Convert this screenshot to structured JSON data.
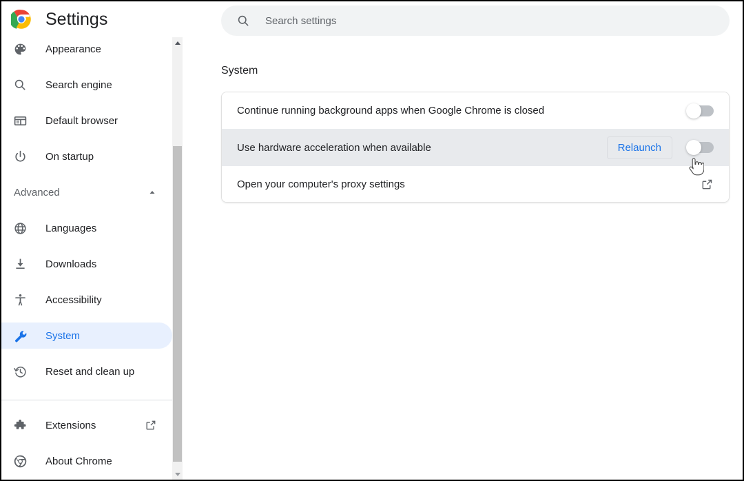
{
  "app": {
    "title": "Settings",
    "logo_icon": "chrome-logo"
  },
  "search": {
    "placeholder": "Search settings",
    "value": "",
    "icon": "search-icon"
  },
  "sidebar": {
    "items_top": [
      {
        "label": "Appearance",
        "icon": "palette-icon",
        "selected": false
      },
      {
        "label": "Search engine",
        "icon": "search-icon",
        "selected": false
      },
      {
        "label": "Default browser",
        "icon": "browser-window-icon",
        "selected": false
      },
      {
        "label": "On startup",
        "icon": "power-icon",
        "selected": false
      }
    ],
    "section": {
      "label": "Advanced",
      "chevron_icon": "chevron-up-icon",
      "expanded": true
    },
    "items_advanced": [
      {
        "label": "Languages",
        "icon": "globe-icon",
        "selected": false
      },
      {
        "label": "Downloads",
        "icon": "download-icon",
        "selected": false
      },
      {
        "label": "Accessibility",
        "icon": "accessibility-icon",
        "selected": false
      },
      {
        "label": "System",
        "icon": "wrench-icon",
        "selected": true
      },
      {
        "label": "Reset and clean up",
        "icon": "history-restore-icon",
        "selected": false
      }
    ],
    "items_bottom": [
      {
        "label": "Extensions",
        "icon": "puzzle-piece-icon",
        "trailing_icon": "external-link-icon"
      },
      {
        "label": "About Chrome",
        "icon": "chrome-logo-gray-icon"
      }
    ]
  },
  "main": {
    "section_title": "System",
    "rows": [
      {
        "label": "Continue running background apps when Google Chrome is closed",
        "control": "toggle",
        "toggle_on": false,
        "hovered": false
      },
      {
        "label": "Use hardware acceleration when available",
        "control": "toggle",
        "toggle_on": false,
        "button_label": "Relaunch",
        "hovered": true
      },
      {
        "label": "Open your computer's proxy settings",
        "control": "external-link",
        "hovered": false
      }
    ]
  },
  "scrollbar": {
    "up_icon": "caret-up-icon",
    "down_icon": "caret-down-icon"
  },
  "colors": {
    "accent_blue": "#1a73e8",
    "selected_pill": "#e8f0fe",
    "row_hover": "#e8eaed",
    "search_bg": "#f1f3f4",
    "text_primary": "#202124",
    "text_secondary": "#5f6368",
    "toggle_off_track": "#bdc1c6"
  },
  "cursor": {
    "type": "pointer-hand"
  }
}
